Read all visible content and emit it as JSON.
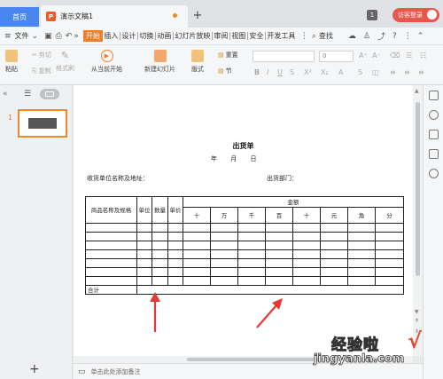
{
  "tabs": {
    "home_label": "首页",
    "doc_label": "演示文稿1",
    "new_tab": "+",
    "badge": "1",
    "guest_login": "访客登录"
  },
  "menu": {
    "file_label": "文件",
    "items": [
      "开始",
      "插入",
      "设计",
      "切换",
      "动画",
      "幻灯片放映",
      "审阅",
      "视图",
      "安全",
      "开发工具"
    ],
    "active_index": 0,
    "search_label": "查找"
  },
  "ribbon": {
    "paste": "粘贴",
    "cut": "剪切",
    "copy": "复制",
    "format_painter": "格式刷",
    "from_current": "从当前开始",
    "new_slide": "新建幻灯片",
    "layout": "版式",
    "reset": "重置",
    "section": "节",
    "font_size": "0"
  },
  "document": {
    "title": "出货单",
    "date_line": "年 月 日",
    "recipient_label": "收货单位名称及地址：",
    "dept_label": "出货部门：",
    "headers": {
      "product": "商品名称及规格",
      "unit": "单位",
      "qty": "数量",
      "price": "单价",
      "amount": "金额",
      "digits": [
        "十",
        "万",
        "千",
        "百",
        "十",
        "元",
        "角",
        "分"
      ]
    },
    "total_label": "合计"
  },
  "slide_panel": {
    "slide_number": "1",
    "add_slide": "+"
  },
  "notes": {
    "placeholder": "单击此处添加备注"
  },
  "watermark": {
    "cn": "经验啦",
    "url": "jingyanla.com",
    "check": "√"
  },
  "colors": {
    "accent": "#ee7f2a",
    "home_tab": "#4a86f0",
    "guest_button": "#e8584a",
    "arrow_red": "#e53935"
  }
}
